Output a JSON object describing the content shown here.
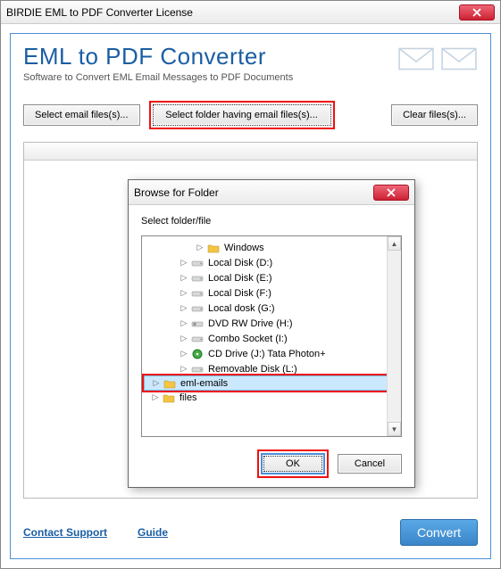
{
  "window": {
    "title": "BIRDIE EML to PDF Converter License"
  },
  "header": {
    "title": "EML to PDF Converter",
    "subtitle": "Software to Convert EML Email Messages to PDF Documents"
  },
  "buttons": {
    "select_files": "Select email files(s)...",
    "select_folder": "Select folder having email files(s)...",
    "clear_files": "Clear files(s)..."
  },
  "dialog": {
    "title": "Browse for Folder",
    "label": "Select folder/file",
    "ok": "OK",
    "cancel": "Cancel",
    "tree": [
      {
        "indent": 58,
        "exp": "▷",
        "icon": "folder",
        "label": "Windows"
      },
      {
        "indent": 40,
        "exp": "▷",
        "icon": "drive",
        "label": "Local Disk (D:)"
      },
      {
        "indent": 40,
        "exp": "▷",
        "icon": "drive",
        "label": "Local Disk (E:)"
      },
      {
        "indent": 40,
        "exp": "▷",
        "icon": "drive",
        "label": "Local Disk (F:)"
      },
      {
        "indent": 40,
        "exp": "▷",
        "icon": "drive",
        "label": "Local dosk  (G:)"
      },
      {
        "indent": 40,
        "exp": "▷",
        "icon": "dvd",
        "label": "DVD RW Drive (H:)"
      },
      {
        "indent": 40,
        "exp": "▷",
        "icon": "drive",
        "label": "Combo Socket (I:)"
      },
      {
        "indent": 40,
        "exp": "▷",
        "icon": "cd",
        "label": "CD Drive (J:) Tata Photon+"
      },
      {
        "indent": 40,
        "exp": "▷",
        "icon": "drive",
        "label": "Removable Disk (L:)"
      },
      {
        "indent": 8,
        "exp": "▷",
        "icon": "folder",
        "label": "eml-emails",
        "selected": true
      },
      {
        "indent": 8,
        "exp": "▷",
        "icon": "folder",
        "label": "files"
      }
    ]
  },
  "footer": {
    "contact": "Contact Support",
    "guide": "Guide",
    "convert": "Convert"
  }
}
